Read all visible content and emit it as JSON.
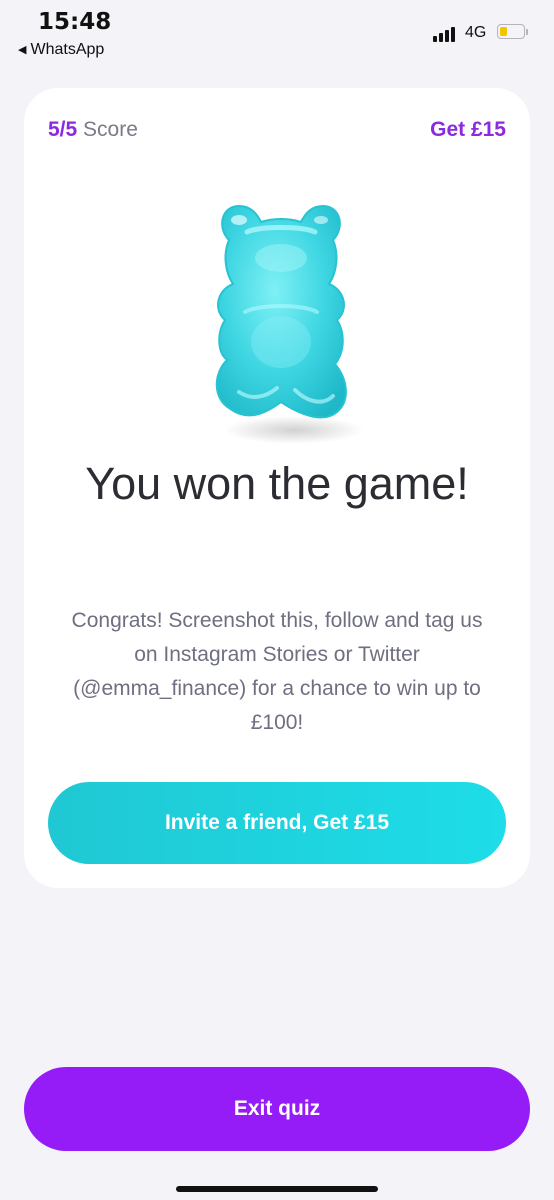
{
  "status_bar": {
    "time": "15:48",
    "back_app": "WhatsApp",
    "network": "4G",
    "battery_level": 0.3
  },
  "quiz_card": {
    "score_value": "5/5",
    "score_label": "Score",
    "get_reward": "Get £15",
    "image_icon": "gummy-bear-icon",
    "title": "You won the game!",
    "body": "Congrats! Screenshot this, follow and tag us on Instagram Stories or Twitter (@emma_finance) for a chance to win up to £100!",
    "invite_button": "Invite a friend, Get £15"
  },
  "footer": {
    "exit_button": "Exit quiz"
  },
  "colors": {
    "accent_purple": "#961cf7",
    "accent_teal": "#1fd3de",
    "background": "#f3f3f8"
  }
}
